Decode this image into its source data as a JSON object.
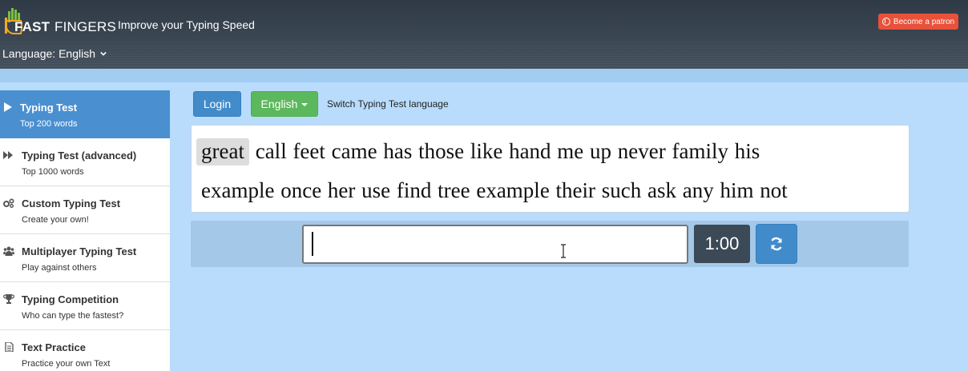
{
  "header": {
    "logo_fast": "FAST",
    "logo_fingers": "FINGERS",
    "tagline": "Improve your Typing Speed",
    "patron_label": "Become a patron",
    "language_label": "Language: English"
  },
  "sidebar": {
    "items": [
      {
        "title": "Typing Test",
        "subtitle": "Top 200 words",
        "icon": "play-icon",
        "active": true
      },
      {
        "title": "Typing Test (advanced)",
        "subtitle": "Top 1000 words",
        "icon": "fast-forward-icon",
        "active": false
      },
      {
        "title": "Custom Typing Test",
        "subtitle": "Create your own!",
        "icon": "gears-icon",
        "active": false
      },
      {
        "title": "Multiplayer Typing Test",
        "subtitle": "Play against others",
        "icon": "users-icon",
        "active": false
      },
      {
        "title": "Typing Competition",
        "subtitle": "Who can type the fastest?",
        "icon": "trophy-icon",
        "active": false
      },
      {
        "title": "Text Practice",
        "subtitle": "Practice your own Text",
        "icon": "document-icon",
        "active": false
      }
    ]
  },
  "main": {
    "login_label": "Login",
    "language_button": "English",
    "switch_language_label": "Switch Typing Test language",
    "current_word": "great",
    "line1_rest": " call feet came has those like hand me up never family his",
    "line2": "example once her use find tree example their such ask any him not",
    "input_value": "",
    "timer": "1:00",
    "reload_icon": "refresh-icon"
  },
  "colors": {
    "header_bg": "#353f4b",
    "page_bg": "#b9dcfc",
    "active_item": "#4a90d0",
    "primary": "#428bca",
    "success": "#5cb85c",
    "patron": "#e8513a",
    "timer_bg": "#3c4a57"
  }
}
